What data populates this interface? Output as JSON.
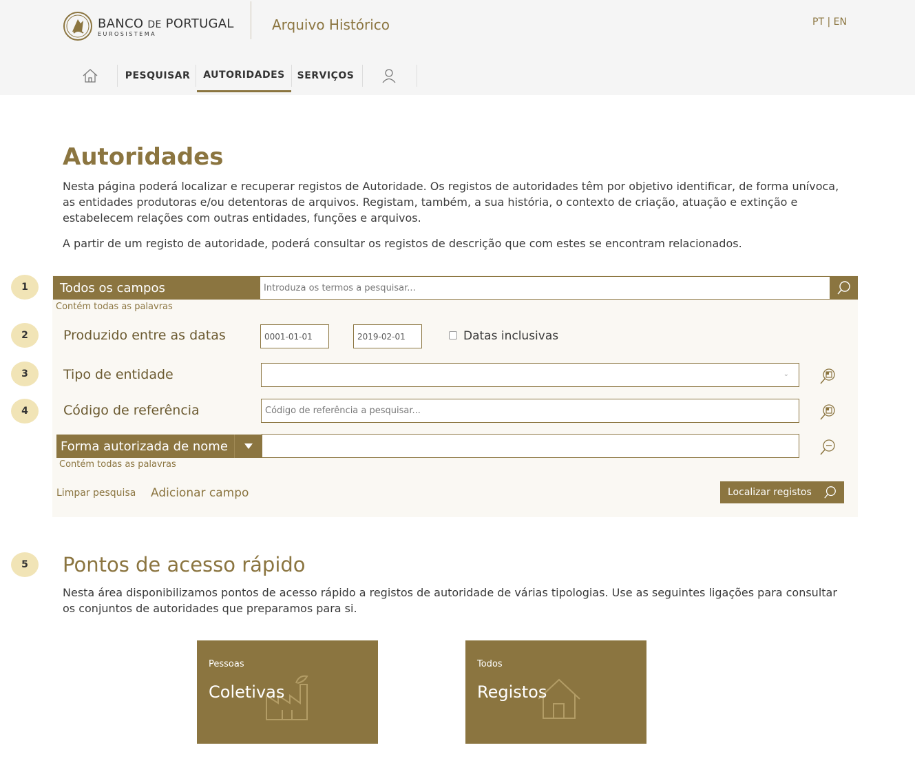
{
  "header": {
    "brand_main": "BANCO",
    "brand_de": "DE",
    "brand_portugal": "PORTUGAL",
    "brand_sub": "EUROSISTEMA",
    "archive_title": "Arquivo Histórico",
    "lang_pt": "PT",
    "lang_sep": " | ",
    "lang_en": "EN"
  },
  "nav": {
    "items": [
      {
        "label": "PESQUISAR"
      },
      {
        "label": "AUTORIDADES"
      },
      {
        "label": "SERVIÇOS"
      }
    ]
  },
  "page": {
    "title": "Autoridades",
    "intro": "Nesta página poderá localizar e recuperar registos de Autoridade. Os registos de autoridades têm por objetivo identificar, de forma unívoca, as entidades produtoras e/ou detentoras de arquivos. Registam, também, a sua história, o contexto de criação, atuação e extinção e estabelecem relações com outras entidades, funções e arquivos.",
    "intro2": "A partir de um registo de autoridade, poderá consultar os registos de descrição que com estes se encontram relacionados."
  },
  "steps": [
    "1",
    "2",
    "3",
    "4",
    "5"
  ],
  "form": {
    "all_fields_label": "Todos os campos",
    "all_fields_placeholder": "Introduza os termos a pesquisar...",
    "all_words_hint": "Contém todas as palavras",
    "dates_label": "Produzido entre as datas",
    "date_from": "0001-01-01",
    "date_to": "2019-02-01",
    "inclusive_label": "Datas inclusivas",
    "entity_type_label": "Tipo de entidade",
    "entity_type_value": "",
    "ref_code_label": "Código de referência",
    "ref_code_placeholder": "Código de referência a pesquisar...",
    "name_field_label": "Forma autorizada de nome",
    "name_hint": "Contém todas as palavras",
    "clear_label": "Limpar pesquisa",
    "add_field_label": "Adicionar campo",
    "locate_label": "Localizar registos"
  },
  "quick_access": {
    "title": "Pontos de acesso rápido",
    "text": "Nesta área disponibilizamos pontos de acesso rápido a registos de autoridade de várias tipologias. Use as seguintes ligações para consultar os conjuntos de autoridades que preparamos para si.",
    "tiles": [
      {
        "sub": "Pessoas",
        "main": "Coletivas",
        "icon": "factory-icon"
      },
      {
        "sub": "Todos",
        "main": "Registos",
        "icon": "house-icon"
      }
    ]
  },
  "colors": {
    "accent": "#8b7540",
    "step_bg": "#f1e4b6",
    "panel_bg": "#faf8f3",
    "header_bg": "#f5f5f5"
  }
}
